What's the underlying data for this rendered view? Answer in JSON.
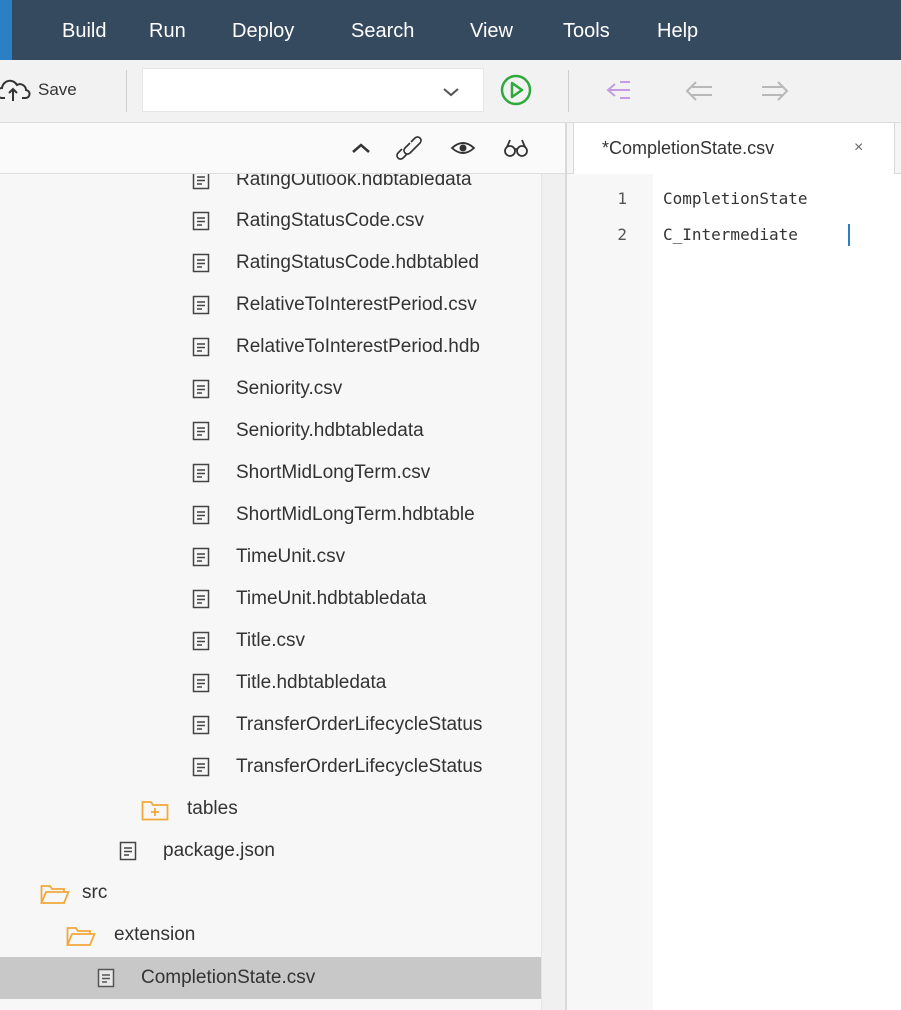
{
  "menubar": {
    "items": [
      "Build",
      "Run",
      "Deploy",
      "Search",
      "View",
      "Tools",
      "Help"
    ]
  },
  "toolbar": {
    "save_label": "Save",
    "combo_value": ""
  },
  "tree": {
    "rows": [
      {
        "label": "RatingOutlook.hdbtabledata",
        "type": "file"
      },
      {
        "label": "RatingStatusCode.csv",
        "type": "file"
      },
      {
        "label": "RatingStatusCode.hdbtabled",
        "type": "file"
      },
      {
        "label": "RelativeToInterestPeriod.csv",
        "type": "file"
      },
      {
        "label": "RelativeToInterestPeriod.hdb",
        "type": "file"
      },
      {
        "label": "Seniority.csv",
        "type": "file"
      },
      {
        "label": "Seniority.hdbtabledata",
        "type": "file"
      },
      {
        "label": "ShortMidLongTerm.csv",
        "type": "file"
      },
      {
        "label": "ShortMidLongTerm.hdbtable",
        "type": "file"
      },
      {
        "label": "TimeUnit.csv",
        "type": "file"
      },
      {
        "label": "TimeUnit.hdbtabledata",
        "type": "file"
      },
      {
        "label": "Title.csv",
        "type": "file"
      },
      {
        "label": "Title.hdbtabledata",
        "type": "file"
      },
      {
        "label": "TransferOrderLifecycleStatus",
        "type": "file"
      },
      {
        "label": "TransferOrderLifecycleStatus",
        "type": "file"
      },
      {
        "label": "tables",
        "type": "folder-closed"
      },
      {
        "label": "package.json",
        "type": "file"
      },
      {
        "label": "src",
        "type": "folder-open"
      },
      {
        "label": "extension",
        "type": "folder-open"
      },
      {
        "label": "CompletionState.csv",
        "type": "file",
        "selected": true
      }
    ]
  },
  "editor": {
    "tab_label": "*CompletionState.csv",
    "tab_close": "×",
    "lines": [
      {
        "no": "1",
        "text": "CompletionState"
      },
      {
        "no": "2",
        "text": "C_Intermediate"
      }
    ]
  },
  "colors": {
    "menubar_bg": "#354a5f",
    "accent": "#2a7fc5",
    "run_green": "#2eaa3b",
    "folder": "#f2a93b"
  },
  "icons": [
    "cloud-upload-icon",
    "chevron-down-icon",
    "run-icon",
    "collapse-all-icon",
    "back-icon",
    "forward-icon",
    "chevron-up-icon",
    "link-icon",
    "eye-icon",
    "binoculars-icon",
    "file-icon",
    "folder-icon",
    "folder-open-icon"
  ]
}
